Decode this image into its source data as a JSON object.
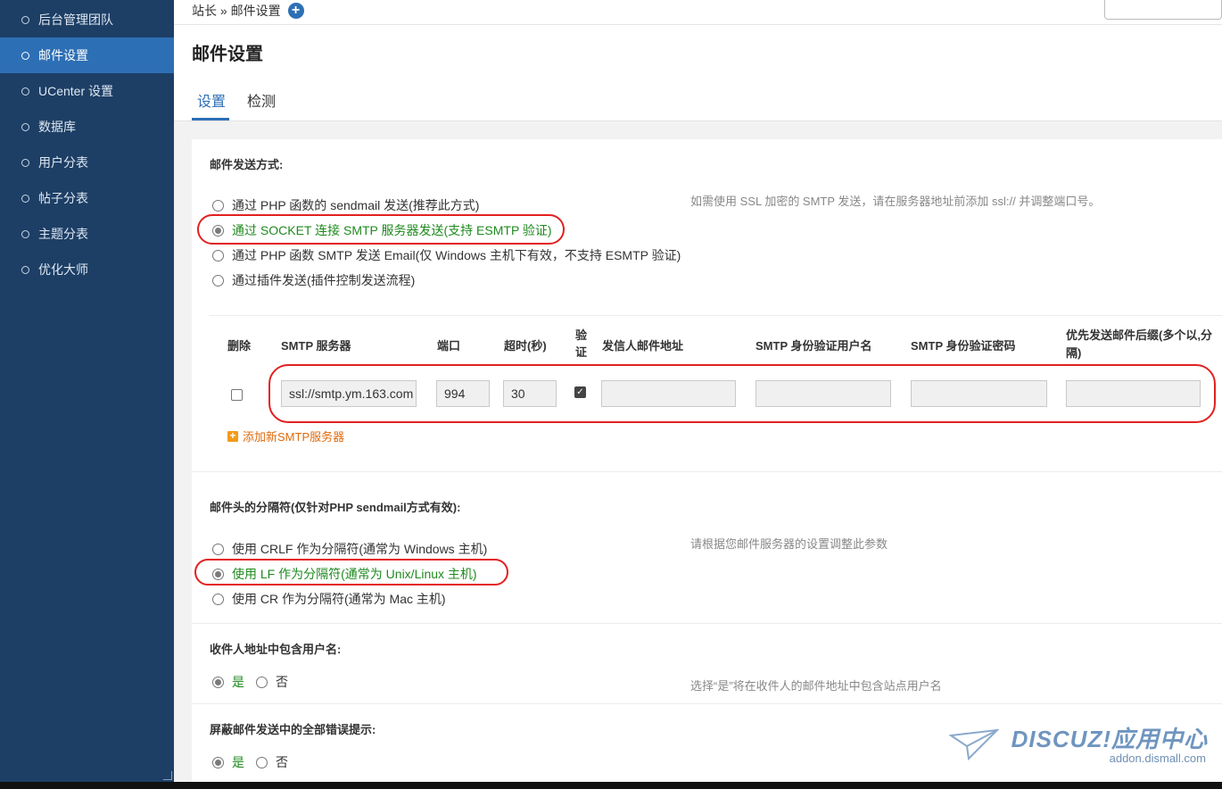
{
  "sidebar": {
    "items": [
      {
        "label": "后台管理团队",
        "active": false
      },
      {
        "label": "邮件设置",
        "active": true
      },
      {
        "label": "UCenter 设置",
        "active": false
      },
      {
        "label": "数据库",
        "active": false
      },
      {
        "label": "用户分表",
        "active": false
      },
      {
        "label": "帖子分表",
        "active": false
      },
      {
        "label": "主题分表",
        "active": false
      },
      {
        "label": "优化大师",
        "active": false
      }
    ]
  },
  "breadcrumb": {
    "text": "站长 » 邮件设置",
    "add_icon": "plus-circle-icon"
  },
  "page": {
    "title": "邮件设置",
    "tabs": [
      {
        "label": "设置",
        "active": true
      },
      {
        "label": "检测",
        "active": false
      }
    ]
  },
  "send_method": {
    "label": "邮件发送方式:",
    "hint": "如需使用 SSL 加密的 SMTP 发送，请在服务器地址前添加 ssl:// 并调整端口号。",
    "options": [
      {
        "label": "通过 PHP 函数的 sendmail 发送(推荐此方式)",
        "selected": false
      },
      {
        "label": "通过 SOCKET 连接 SMTP 服务器发送(支持 ESMTP 验证)",
        "selected": true
      },
      {
        "label": "通过 PHP 函数 SMTP 发送 Email(仅 Windows 主机下有效，不支持 ESMTP 验证)",
        "selected": false
      },
      {
        "label": "通过插件发送(插件控制发送流程)",
        "selected": false
      }
    ]
  },
  "smtp_table": {
    "headers": {
      "delete": "删除",
      "server": "SMTP 服务器",
      "port": "端口",
      "timeout": "超时(秒)",
      "auth": "验证",
      "from": "发信人邮件地址",
      "username": "SMTP 身份验证用户名",
      "password": "SMTP 身份验证密码",
      "suffix": "优先发送邮件后缀(多个以,分隔)"
    },
    "row": {
      "delete_checked": false,
      "server": "ssl://smtp.ym.163.com",
      "port": "994",
      "timeout": "30",
      "auth_checked": true,
      "from": "",
      "username": "",
      "password": "",
      "suffix": ""
    },
    "add_label": "添加新SMTP服务器"
  },
  "header_separator": {
    "label": "邮件头的分隔符(仅针对PHP sendmail方式有效):",
    "hint": "请根据您邮件服务器的设置调整此参数",
    "options": [
      {
        "label": "使用 CRLF 作为分隔符(通常为 Windows 主机)",
        "selected": false
      },
      {
        "label": "使用 LF 作为分隔符(通常为 Unix/Linux 主机)",
        "selected": true
      },
      {
        "label": "使用 CR 作为分隔符(通常为 Mac 主机)",
        "selected": false
      }
    ]
  },
  "include_username": {
    "label": "收件人地址中包含用户名:",
    "hint": "选择“是”将在收件人的邮件地址中包含站点用户名",
    "yes": "是",
    "no": "否",
    "value": "yes"
  },
  "silent_errors": {
    "label": "屏蔽邮件发送中的全部错误提示:",
    "yes": "是",
    "no": "否",
    "value": "yes"
  },
  "watermark": {
    "brand": "DISCUZ!应用中心",
    "domain": "addon.dismall.com"
  },
  "colors": {
    "sidebar": "#1d3f66",
    "active": "#2d6fb5",
    "annotation": "#e32020"
  }
}
